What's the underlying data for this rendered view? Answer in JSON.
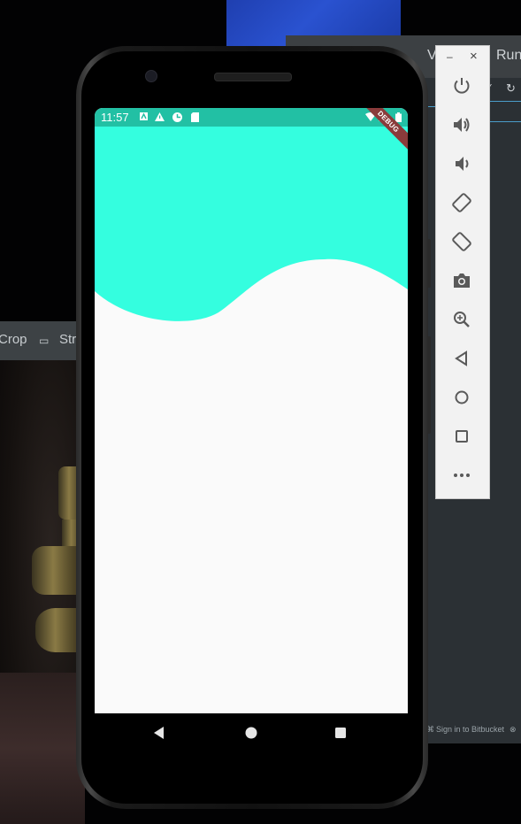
{
  "ide": {
    "menu_partial_v": "V",
    "menu_run": "Run",
    "status_sign_in": "Sign in to Bitbucket"
  },
  "left_toolbar": {
    "crop": "Crop",
    "straighten": "Str"
  },
  "phone": {
    "status_time": "11:57",
    "debug_banner": "DEBUG",
    "app_colors": {
      "header": "#34fedf",
      "status_bar": "#22c0a4",
      "background": "#fafafa"
    }
  },
  "emulator_controls": {
    "minimize_label": "–",
    "close_label": "×",
    "items": [
      {
        "name": "power-icon"
      },
      {
        "name": "volume-up-icon"
      },
      {
        "name": "volume-down-icon"
      },
      {
        "name": "rotate-left-icon"
      },
      {
        "name": "rotate-right-icon"
      },
      {
        "name": "camera-icon"
      },
      {
        "name": "zoom-icon"
      },
      {
        "name": "back-icon"
      },
      {
        "name": "home-icon"
      },
      {
        "name": "overview-icon"
      },
      {
        "name": "more-icon"
      }
    ]
  }
}
